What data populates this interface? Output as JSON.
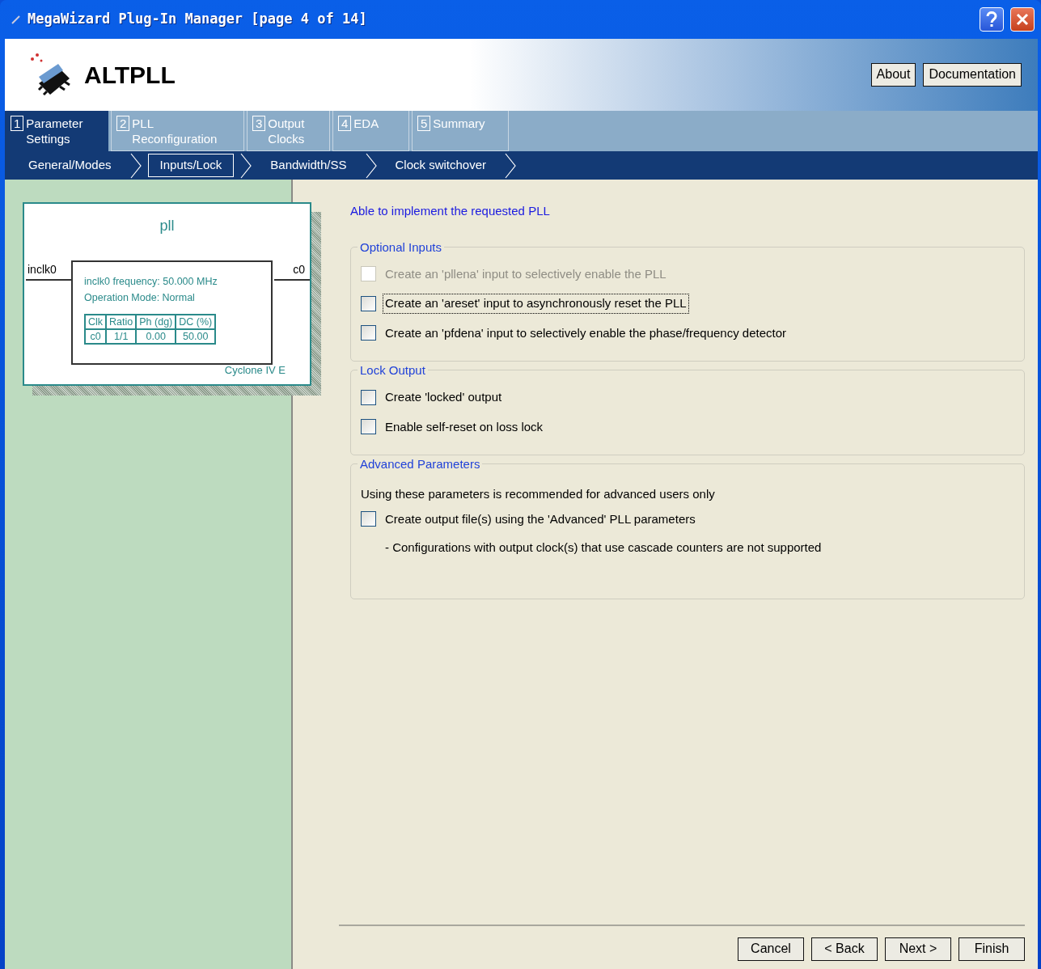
{
  "window": {
    "title": "MegaWizard Plug-In Manager [page 4 of 14]"
  },
  "header": {
    "title": "ALTPLL",
    "buttons": [
      "About",
      "Documentation"
    ]
  },
  "tabs": [
    {
      "number": "1",
      "label": "Parameter Settings",
      "selected": true
    },
    {
      "number": "2",
      "label": "PLL Reconfiguration",
      "selected": false
    },
    {
      "number": "3",
      "label": "Output Clocks",
      "selected": false
    },
    {
      "number": "4",
      "label": "EDA",
      "selected": false
    },
    {
      "number": "5",
      "label": "Summary",
      "selected": false
    }
  ],
  "subtabs": [
    {
      "label": "General/Modes",
      "selected": false
    },
    {
      "label": "Inputs/Lock",
      "selected": true
    },
    {
      "label": "Bandwidth/SS",
      "selected": false
    },
    {
      "label": "Clock switchover",
      "selected": false
    }
  ],
  "diagram": {
    "name": "pll",
    "input": "inclk0",
    "output": "c0",
    "info": [
      "inclk0 frequency: 50.000 MHz",
      "Operation Mode: Normal"
    ],
    "table": {
      "columns": [
        "Clk",
        "Ratio",
        "Ph (dg)",
        "DC (%)"
      ],
      "rows": [
        [
          "c0",
          "1/1",
          "0.00",
          "50.00"
        ]
      ]
    },
    "device": "Cyclone IV E"
  },
  "status": "Able to implement the requested PLL",
  "groups": [
    {
      "title": "Optional Inputs",
      "items": [
        {
          "kind": "checkbox",
          "label": "Create an 'pllena' input to selectively enable the PLL",
          "checked": false,
          "disabled": true,
          "focused": false
        },
        {
          "kind": "checkbox",
          "label": "Create an 'areset' input to asynchronously reset the PLL",
          "checked": false,
          "disabled": false,
          "focused": true
        },
        {
          "kind": "checkbox",
          "label": "Create an 'pfdena' input to selectively enable the phase/frequency detector",
          "checked": false,
          "disabled": false,
          "focused": false
        }
      ]
    },
    {
      "title": "Lock Output",
      "items": [
        {
          "kind": "checkbox",
          "label": "Create 'locked' output",
          "checked": false,
          "disabled": false,
          "focused": false
        },
        {
          "kind": "checkbox",
          "label": "Enable self-reset on loss lock",
          "checked": false,
          "disabled": false,
          "focused": false
        }
      ]
    },
    {
      "title": "Advanced Parameters",
      "items": [
        {
          "kind": "text",
          "label": "Using these parameters is recommended for advanced users only"
        },
        {
          "kind": "checkbox",
          "label": "Create output file(s) using the 'Advanced' PLL parameters",
          "checked": false,
          "disabled": false,
          "focused": false
        },
        {
          "kind": "note",
          "label": "- Configurations with output clock(s) that use cascade counters are not supported"
        }
      ]
    }
  ],
  "footer_buttons": [
    "Cancel",
    "< Back",
    "Next >",
    "Finish"
  ]
}
